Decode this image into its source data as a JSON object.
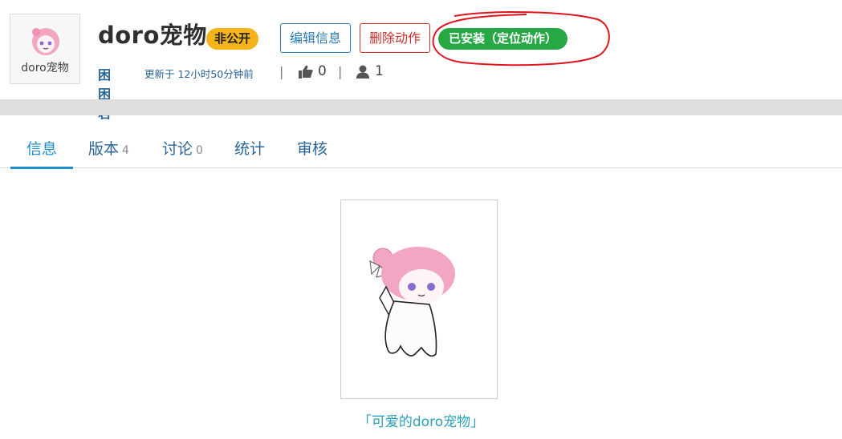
{
  "header": {
    "thumbnail_caption": "doro宠物",
    "title": "doro宠物",
    "visibility_badge": "非公开",
    "edit_button": "编辑信息",
    "delete_button": "删除动作",
    "installed_badge": "已安装（定位动作）"
  },
  "meta": {
    "author": "困困君",
    "updated": "更新于 12小时50分钟前",
    "separator": "|",
    "likes": "0",
    "users": "1"
  },
  "tabs": [
    {
      "label": "信息",
      "count": ""
    },
    {
      "label": "版本",
      "count": "4"
    },
    {
      "label": "讨论",
      "count": "0"
    },
    {
      "label": "统计",
      "count": ""
    },
    {
      "label": "审核",
      "count": ""
    }
  ],
  "main": {
    "image_caption": "「可爱的doro宠物」"
  },
  "colors": {
    "link": "#2a6496",
    "badge_yellow": "#f4b41a",
    "installed_green": "#28a745",
    "delete_red": "#c9302c",
    "annotation_red": "#e0141e"
  }
}
